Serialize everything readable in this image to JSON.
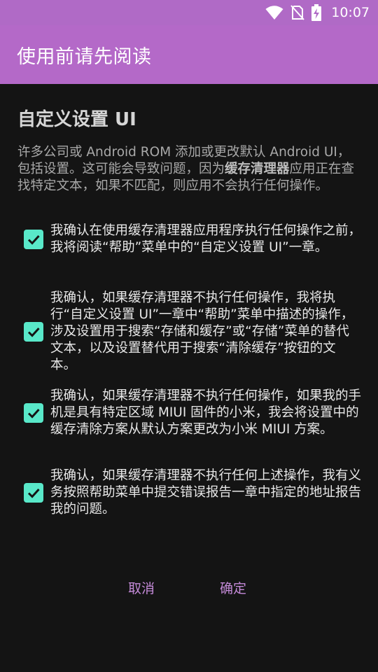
{
  "status_bar": {
    "time": "10:07",
    "icons": [
      "wifi-icon",
      "no-sim-icon",
      "battery-charging-icon"
    ]
  },
  "app_bar": {
    "title": "使用前请先阅读"
  },
  "dialog": {
    "title": "自定义设置 UI",
    "intro_before": "许多公司或 Android ROM 添加或更改默认 Android UI，包括设置。这可能会导致问题，因为",
    "intro_bold": "缓存清理器",
    "intro_after": "应用正在查找特定文本，如果不匹配，则应用不会执行任何操作。",
    "checkboxes": [
      {
        "text": "我确认在使用缓存清理器应用程序执行任何操作之前，我将阅读“帮助”菜单中的“自定义设置 UI”一章。",
        "checked": true
      },
      {
        "text": "我确认，如果缓存清理器不执行任何操作，我将执行“自定义设置 UI”一章中“帮助”菜单中描述的操作，涉及设置用于搜索“存储和缓存”或“存储”菜单的替代文本，以及设置替代用于搜索“清除缓存”按钮的文本。",
        "checked": true
      },
      {
        "text": "我确认，如果缓存清理器不执行任何操作，如果我的手机是具有特定区域 MIUI 固件的小米，我会将设置中的缓存清除方案从默认方案更改为小米 MIUI 方案。",
        "checked": true
      },
      {
        "text": "我确认，如果缓存清理器不执行任何上述操作，我有义务按照帮助菜单中提交错误报告一章中指定的地址报告我的问题。",
        "checked": true
      }
    ],
    "cancel_label": "取消",
    "ok_label": "确定"
  },
  "colors": {
    "status_bar": "#B06AC6",
    "app_bar": "#B469C8",
    "background": "#141414",
    "checkbox": "#59E8C9",
    "button_text": "#C48AD8"
  }
}
